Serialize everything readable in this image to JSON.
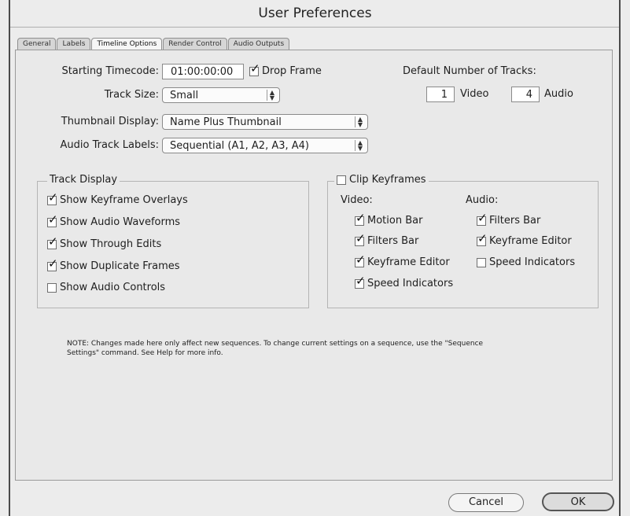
{
  "window": {
    "title": "User Preferences"
  },
  "tabs": [
    {
      "label": "General",
      "active": false
    },
    {
      "label": "Labels",
      "active": false
    },
    {
      "label": "Timeline Options",
      "active": true
    },
    {
      "label": "Render Control",
      "active": false
    },
    {
      "label": "Audio Outputs",
      "active": false
    }
  ],
  "timeline": {
    "starting_timecode_label": "Starting Timecode:",
    "starting_timecode_value": "01:00:00:00",
    "drop_frame_label": "Drop Frame",
    "drop_frame_checked": true,
    "track_size_label": "Track Size:",
    "track_size_value": "Small",
    "thumbnail_display_label": "Thumbnail Display:",
    "thumbnail_display_value": "Name Plus Thumbnail",
    "audio_track_labels_label": "Audio Track Labels:",
    "audio_track_labels_value": "Sequential (A1, A2, A3, A4)",
    "default_tracks_label": "Default Number of Tracks:",
    "video_tracks_value": "1",
    "video_tracks_label": "Video",
    "audio_tracks_value": "4",
    "audio_tracks_label": "Audio"
  },
  "track_display": {
    "title": "Track Display",
    "items": [
      {
        "label": "Show Keyframe Overlays",
        "checked": true
      },
      {
        "label": "Show Audio Waveforms",
        "checked": true
      },
      {
        "label": "Show Through Edits",
        "checked": true
      },
      {
        "label": "Show Duplicate Frames",
        "checked": true
      },
      {
        "label": "Show Audio Controls",
        "checked": false
      }
    ]
  },
  "clip_keyframes": {
    "title": "Clip Keyframes",
    "checked": false,
    "video_label": "Video:",
    "audio_label": "Audio:",
    "video_items": [
      {
        "label": "Motion Bar",
        "checked": true
      },
      {
        "label": "Filters Bar",
        "checked": true
      },
      {
        "label": "Keyframe Editor",
        "checked": true
      },
      {
        "label": "Speed Indicators",
        "checked": true
      }
    ],
    "audio_items": [
      {
        "label": "Filters Bar",
        "checked": true
      },
      {
        "label": "Keyframe Editor",
        "checked": true
      },
      {
        "label": "Speed Indicators",
        "checked": false
      }
    ]
  },
  "note": {
    "line1": "NOTE: Changes made here only affect new sequences. To change current settings on a sequence, use the \"Sequence",
    "line2": "Settings\" command. See Help for more info."
  },
  "buttons": {
    "cancel": "Cancel",
    "ok": "OK"
  },
  "glyphs": {
    "check": "✓",
    "popup_up": "▲",
    "popup_down": "▼"
  }
}
